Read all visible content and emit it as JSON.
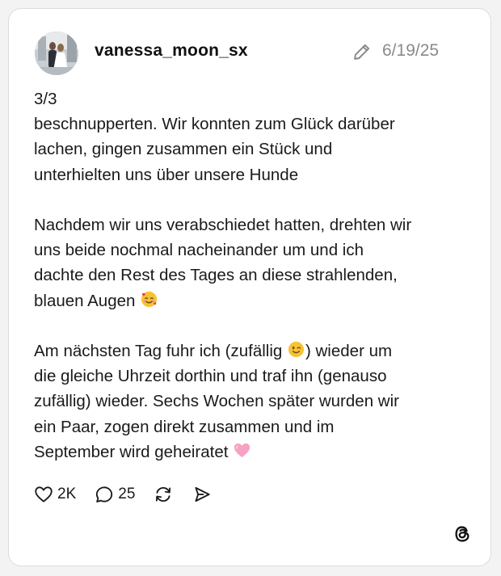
{
  "post": {
    "username": "vanessa_moon_sx",
    "date": "6/19/25",
    "paragraphs": [
      [
        "3/3",
        "beschnupperten. Wir konnten zum Glück darüber",
        "lachen, gingen zusammen ein Stück und",
        "unterhielten uns über unsere Hunde"
      ],
      [
        "Nachdem wir uns verabschiedet hatten, drehten wir",
        "uns beide nochmal nacheinander um und ich",
        "dachte den Rest des Tages an diese strahlenden,",
        "blauen Augen"
      ],
      [
        "Am nächsten Tag fuhr ich (zufällig",
        ") wieder um",
        "die gleiche Uhrzeit dorthin und traf ihn (genauso",
        "zufällig) wieder. Sechs Wochen später wurden wir",
        "ein Paar, zogen direkt zusammen und im",
        "September wird geheiratet"
      ]
    ]
  },
  "actions": {
    "likes": "2K",
    "comments": "25"
  },
  "icons": {
    "edit": "pencil-icon",
    "like": "heart-icon",
    "comment": "comment-bubble-icon",
    "repost": "repost-icon",
    "share": "send-icon",
    "brand": "threads-logo-icon"
  },
  "colors": {
    "text": "#1a1a1a",
    "muted": "#8a8a8a",
    "border": "#dcdcdc"
  }
}
